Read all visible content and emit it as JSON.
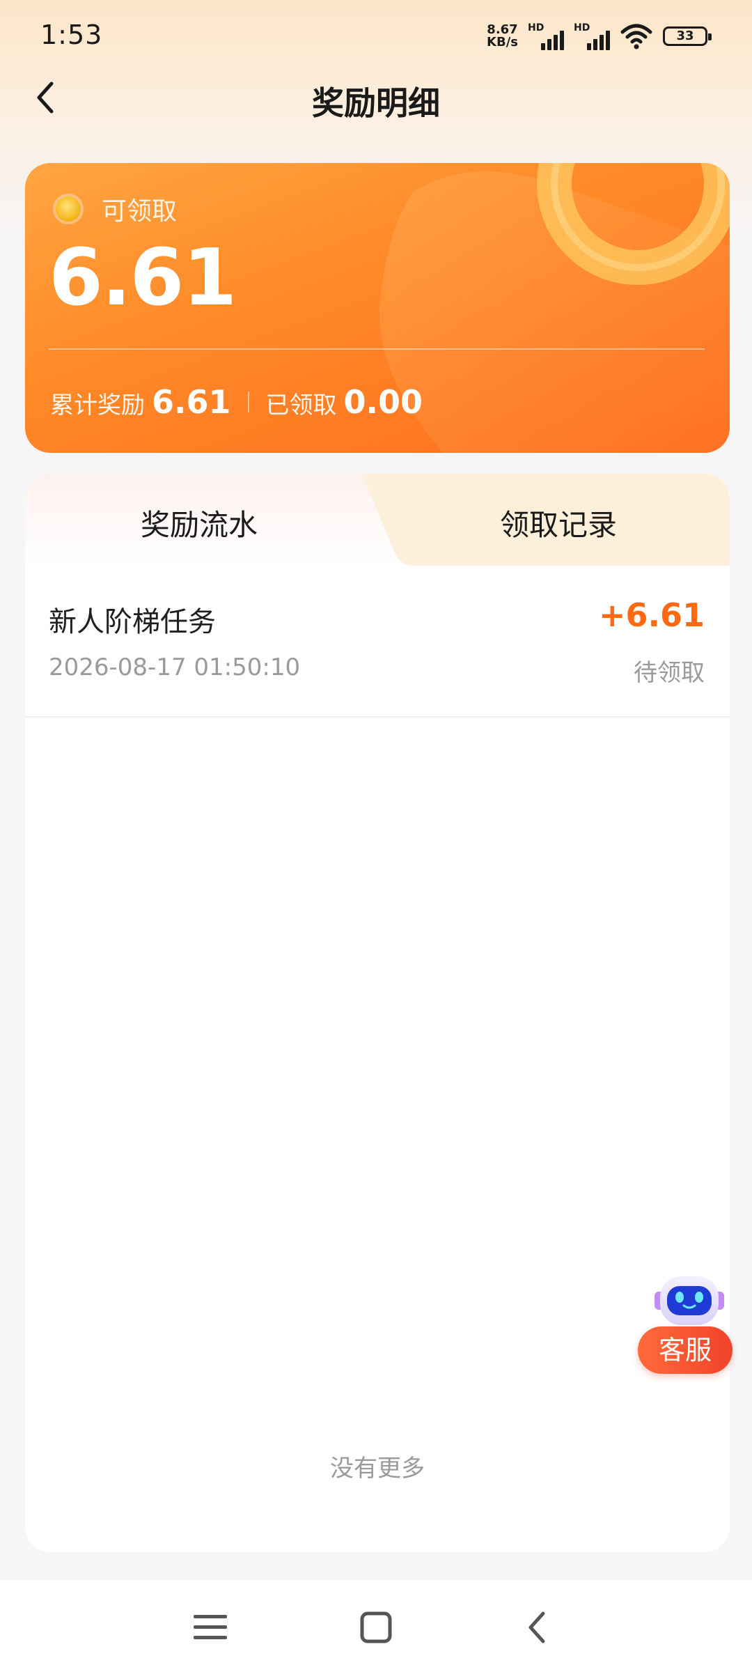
{
  "status_bar": {
    "time": "1:53",
    "net_speed_value": "8.67",
    "net_speed_unit": "KB/s",
    "sim1_label": "HD",
    "sim2_label": "HD",
    "battery_level": "33"
  },
  "header": {
    "title": "奖励明细",
    "back_icon": "chevron-left-icon"
  },
  "reward_card": {
    "label": "可领取",
    "claimable_amount": "6.61",
    "total_label": "累计奖励",
    "total_value": "6.61",
    "claimed_label": "已领取",
    "claimed_value": "0.00",
    "accent_color": "#ff7a22"
  },
  "tabs": [
    {
      "label": "奖励流水",
      "active": true
    },
    {
      "label": "领取记录",
      "active": false
    }
  ],
  "records": [
    {
      "title": "新人阶梯任务",
      "amount": "+6.61",
      "time": "2026-08-17 01:50:10",
      "status": "待领取"
    }
  ],
  "list_footer": "没有更多",
  "customer_service": {
    "label": "客服",
    "icon": "robot-icon"
  },
  "nav_bar": {
    "icons": [
      "menu-icon",
      "home-icon",
      "back-icon"
    ]
  },
  "colors": {
    "amount_orange": "#ff6a12",
    "cs_red": "#f0432b",
    "tab_inactive_bg": "#fdf0da"
  }
}
